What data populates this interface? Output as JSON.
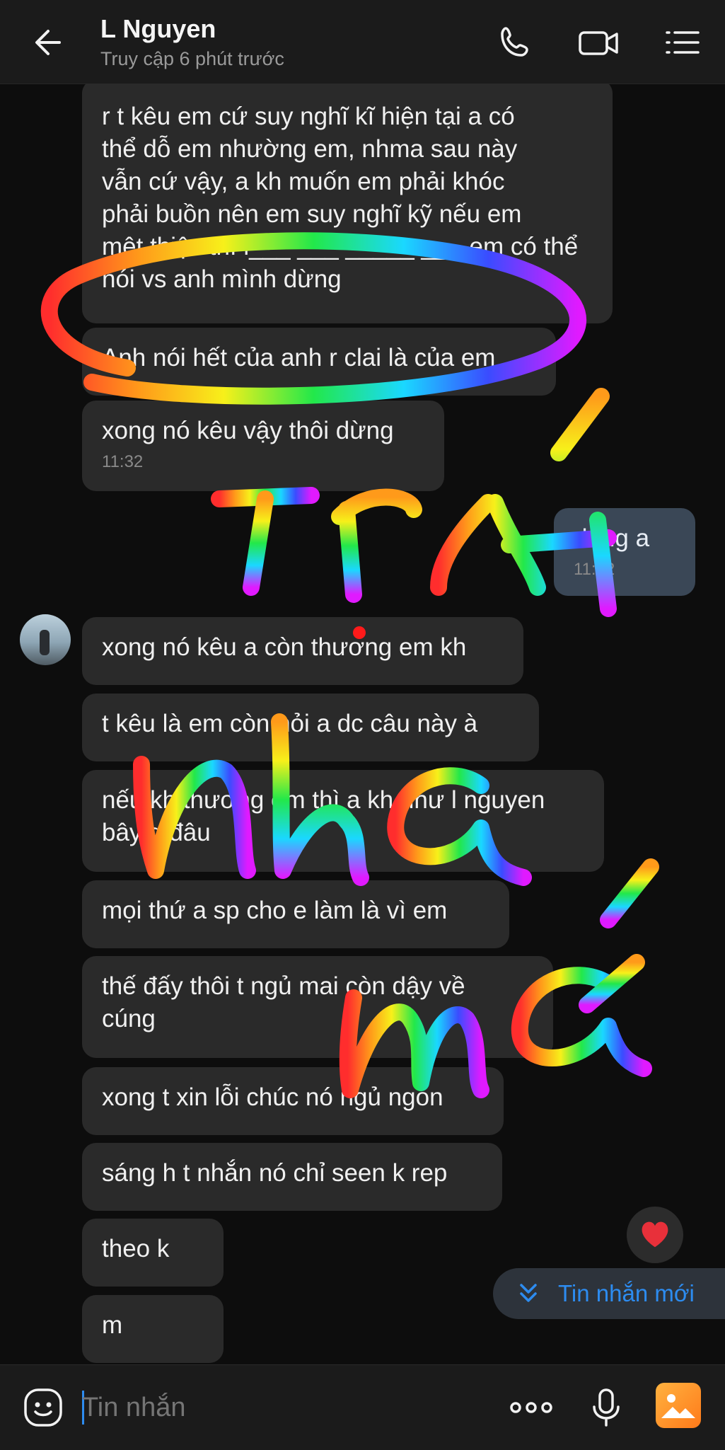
{
  "header": {
    "title": "L Nguyen",
    "subtitle": "Truy cập 6 phút trước"
  },
  "messages": [
    {
      "text": "r t kêu em cứ suy nghĩ kĩ hiện tại a có\nthể dỗ em nhường em, nhma sau này\nvẫn cứ vậy, a kh muốn em phải khóc\nphải buồn nên em suy nghĩ kỹ nếu em\nmệt thiệc thì l___ ___ _____ ___ em có thể\nnói vs anh mình dừng"
    },
    {
      "text": "Anh nói hết của anh r clai là của em"
    },
    {
      "text": "xong nó kêu vậy thôi dừng",
      "time": "11:32"
    },
    {
      "text": "dung a",
      "time": "11:32"
    },
    {
      "text": "xong nó kêu a còn thương em kh"
    },
    {
      "text": "t kêu là em còn hỏi a dc câu này à"
    },
    {
      "text": "nếu kh thương em thì a kh như l nguyen\nbây g đâu"
    },
    {
      "text": "mọi thứ a sp cho e làm là vì em"
    },
    {
      "text": "thế đấy thôi t ngủ mai còn dậy về\ncúng"
    },
    {
      "text": "xong t xin lỗi chúc nó ngủ ngon"
    },
    {
      "text": "sáng h t nhắn nó chỉ seen k rep"
    },
    {
      "text": "theo k"
    },
    {
      "text": "m"
    }
  ],
  "new_message_label": "Tin nhắn mới",
  "composer": {
    "placeholder": "Tin nhắn"
  },
  "icons": [
    "back-arrow-icon",
    "phone-icon",
    "video-call-icon",
    "menu-list-icon",
    "heart-icon",
    "chevron-double-down-icon",
    "emoji-icon",
    "more-dots-icon",
    "microphone-icon",
    "gallery-icon"
  ],
  "colors": {
    "accent": "#2d8cf0",
    "bubble": "#2a2a2a",
    "header": "#1b1b1b",
    "heart": "#e8303a"
  }
}
